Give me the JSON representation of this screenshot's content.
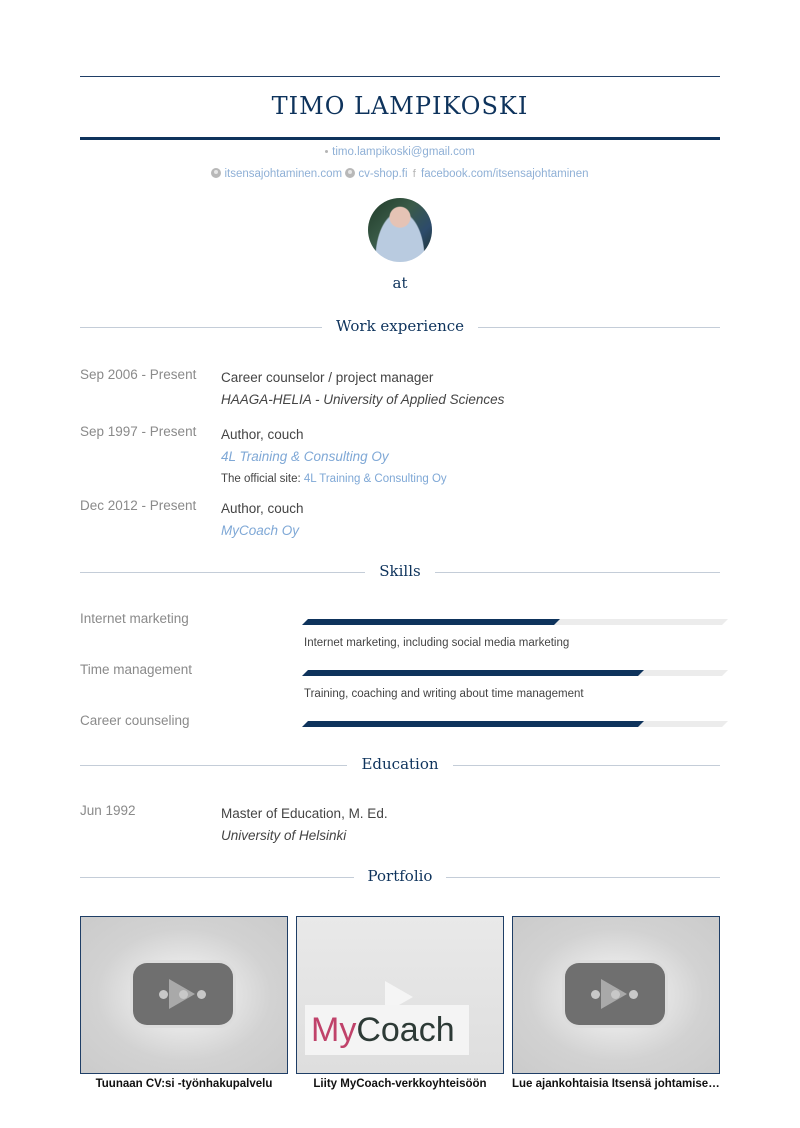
{
  "header": {
    "name": "TIMO LAMPIKOSKI",
    "email": "timo.lampikoski@gmail.com",
    "links": [
      {
        "icon": "globe-icon",
        "label": "itsensajohtaminen.com"
      },
      {
        "icon": "globe-icon",
        "label": "cv-shop.fi"
      },
      {
        "icon": "facebook-icon",
        "label": "facebook.com/itsensajohtaminen"
      }
    ],
    "headline": "at"
  },
  "sections": {
    "work": "Work experience",
    "skills": "Skills",
    "education": "Education",
    "portfolio": "Portfolio"
  },
  "work": [
    {
      "date": "Sep 2006 - Present",
      "role": "Career counselor / project manager",
      "org": "HAAGA-HELIA - University of Applied Sciences"
    },
    {
      "date": "Sep 1997 - Present",
      "role": "Author, couch",
      "org": "4L Training & Consulting Oy",
      "note_prefix": "The official site:",
      "note_link": "4L Training & Consulting Oy"
    },
    {
      "date": "Dec 2012 - Present",
      "role": "Author, couch",
      "org": "MyCoach Oy"
    }
  ],
  "skills": [
    {
      "name": "Internet marketing",
      "level": 0.6,
      "description": "Internet marketing, including social media marketing"
    },
    {
      "name": "Time management",
      "level": 0.8,
      "description": "Training, coaching and writing about time management"
    },
    {
      "name": "Career counseling",
      "level": 0.8,
      "description": ""
    }
  ],
  "education": [
    {
      "date": "Jun 1992",
      "degree": "Master of Education, M. Ed.",
      "school": "University of Helsinki"
    }
  ],
  "portfolio": [
    {
      "title": "Tuunaan CV:si -työnhakupalvelu",
      "thumb": "video-placeholder"
    },
    {
      "title": "Liity MyCoach-verkkoyhteisöön",
      "thumb": "mycoach",
      "logo_my": "My",
      "logo_coach": "Coach"
    },
    {
      "title": "Lue ajankohtaisia Itsensä johtamisen...",
      "thumb": "video-placeholder"
    }
  ],
  "colors": {
    "accent": "#0e335c",
    "link": "#7fa8d6",
    "muted": "#8a8a8a"
  }
}
